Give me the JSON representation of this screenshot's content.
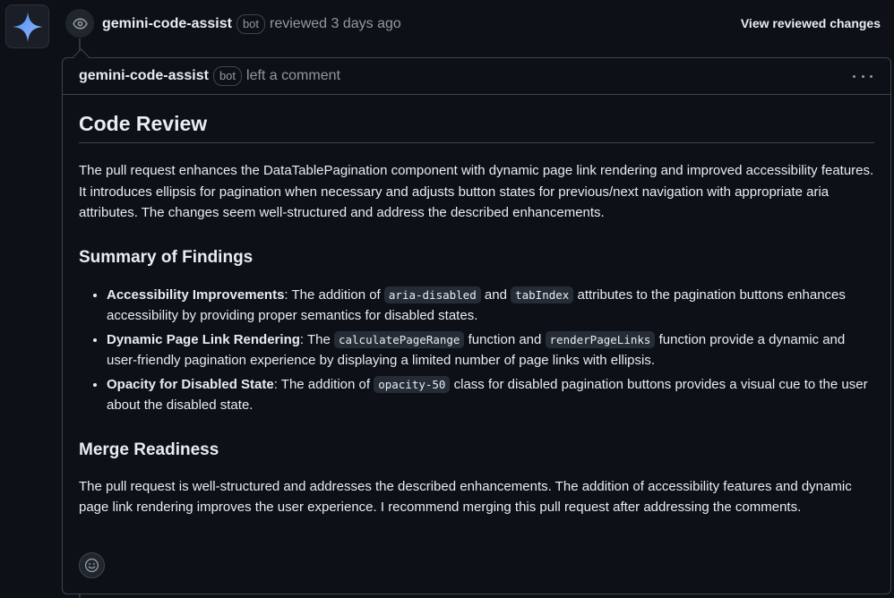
{
  "review_event": {
    "author": "gemini-code-assist",
    "badge": "bot",
    "action": "reviewed 3 days ago",
    "view_changes_label": "View reviewed changes"
  },
  "comment": {
    "author": "gemini-code-assist",
    "badge": "bot",
    "action": "left a comment",
    "title": "Code Review",
    "intro": "The pull request enhances the DataTablePagination component with dynamic page link rendering and improved accessibility features. It introduces ellipsis for pagination when necessary and adjusts button states for previous/next navigation with appropriate aria attributes. The changes seem well-structured and address the described enhancements.",
    "summary_heading": "Summary of Findings",
    "findings": [
      {
        "label": "Accessibility Improvements",
        "t1": ": The addition of ",
        "c1": "aria-disabled",
        "t2": " and ",
        "c2": "tabIndex",
        "t3": " attributes to the pagination buttons enhances accessibility by providing proper semantics for disabled states."
      },
      {
        "label": "Dynamic Page Link Rendering",
        "t1": ": The ",
        "c1": "calculatePageRange",
        "t2": " function and ",
        "c2": "renderPageLinks",
        "t3": " function provide a dynamic and user-friendly pagination experience by displaying a limited number of page links with ellipsis."
      },
      {
        "label": "Opacity for Disabled State",
        "t1": ": The addition of ",
        "c1": "opacity-50",
        "t2": " class for disabled pagination buttons provides a visual cue to the user about the disabled state."
      }
    ],
    "merge_heading": "Merge Readiness",
    "merge_text": "The pull request is well-structured and addresses the described enhancements. The addition of accessibility features and dynamic page link rendering improves the user experience. I recommend merging this pull request after addressing the comments."
  },
  "icons": {
    "avatar": "gemini-sparkle-icon",
    "event": "eye-icon",
    "menu": "kebab-menu-icon",
    "reaction": "smiley-icon"
  },
  "colors": {
    "background": "#0d1117",
    "border": "#3d444d",
    "text": "#e6edf3",
    "muted": "#9198a1",
    "sparkle": "#4c8df6"
  }
}
